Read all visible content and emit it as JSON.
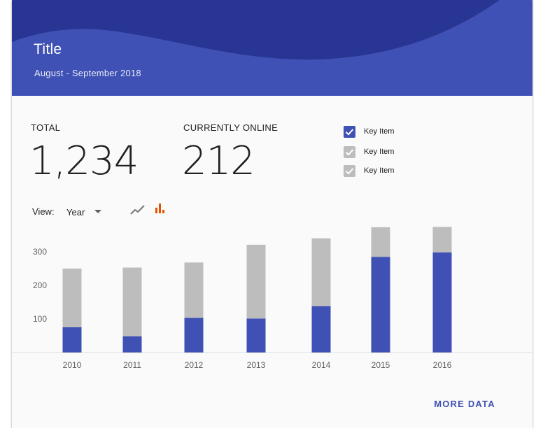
{
  "header": {
    "title": "Title",
    "subtitle": "August - September 2018"
  },
  "stats": [
    {
      "label": "TOTAL",
      "value": "1,234"
    },
    {
      "label": "CURRENTLY ONLINE",
      "value": "212"
    }
  ],
  "key_items": [
    {
      "label": "Key Item",
      "checked": true,
      "color": "#3f51b5"
    },
    {
      "label": "Key Item",
      "checked": true,
      "color": "#bdbdbd"
    },
    {
      "label": "Key Item",
      "checked": true,
      "color": "#bdbdbd"
    }
  ],
  "view": {
    "label": "View:",
    "selected": "Year",
    "icons": [
      "line-chart-icon",
      "bar-chart-icon"
    ],
    "active_icon": "bar-chart-icon"
  },
  "colors": {
    "primary": "#3f51b5",
    "header_dark": "#283593",
    "secondary_bar": "#bdbdbd",
    "accent": "#e65100"
  },
  "chart_data": {
    "type": "bar",
    "stacked": true,
    "categories": [
      "2010",
      "2011",
      "2012",
      "2013",
      "2014",
      "2015",
      "2016"
    ],
    "series": [
      {
        "values": [
          75,
          48,
          103,
          101,
          138,
          285,
          298
        ],
        "color": "#3f51b5"
      },
      {
        "values": [
          175,
          205,
          165,
          220,
          202,
          88,
          76
        ],
        "color": "#bdbdbd"
      }
    ],
    "y_ticks": [
      100,
      200,
      300
    ],
    "ylim": [
      0,
      380
    ],
    "grid": false
  },
  "footer": {
    "more_label": "MORE DATA"
  }
}
